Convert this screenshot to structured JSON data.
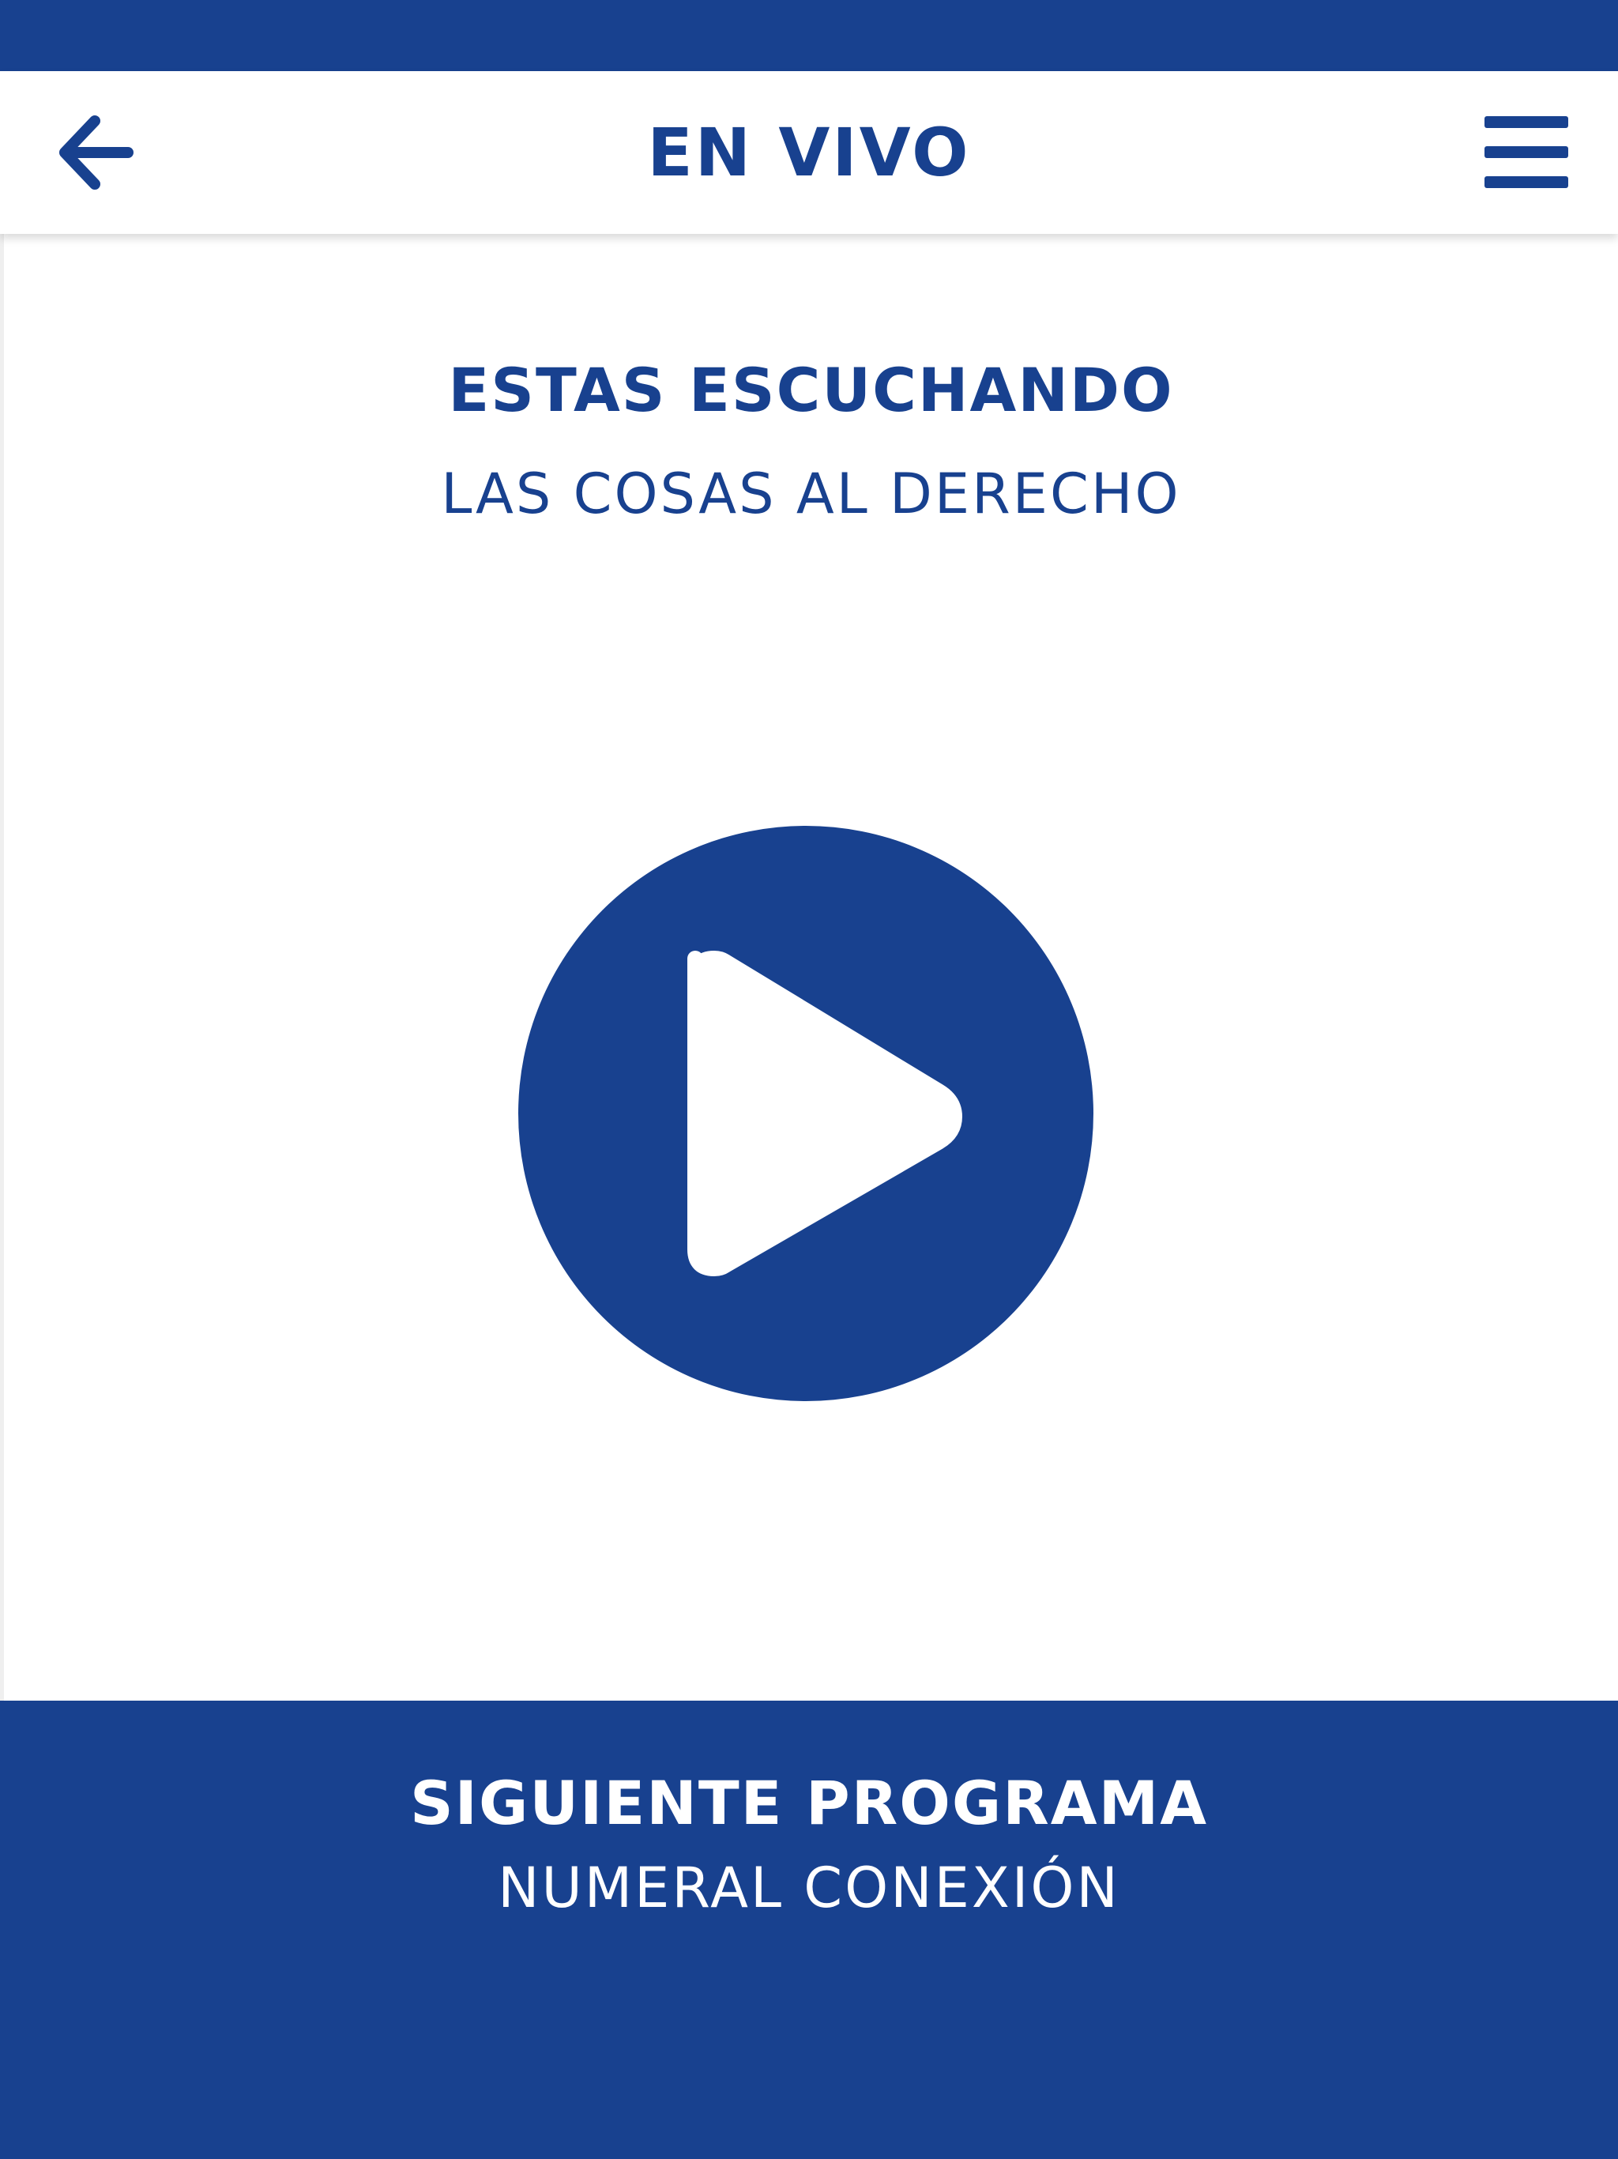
{
  "header": {
    "title": "EN VIVO",
    "back_icon": "arrow-left-icon",
    "menu_icon": "hamburger-menu-icon"
  },
  "now_playing": {
    "heading": "ESTAS ESCUCHANDO",
    "program": "LAS COSAS AL DERECHO",
    "play_icon": "play-icon"
  },
  "next_program": {
    "heading": "SIGUIENTE PROGRAMA",
    "program": "NUMERAL CONEXIÓN"
  },
  "colors": {
    "brand_blue": "#18418f",
    "background": "#ffffff"
  }
}
